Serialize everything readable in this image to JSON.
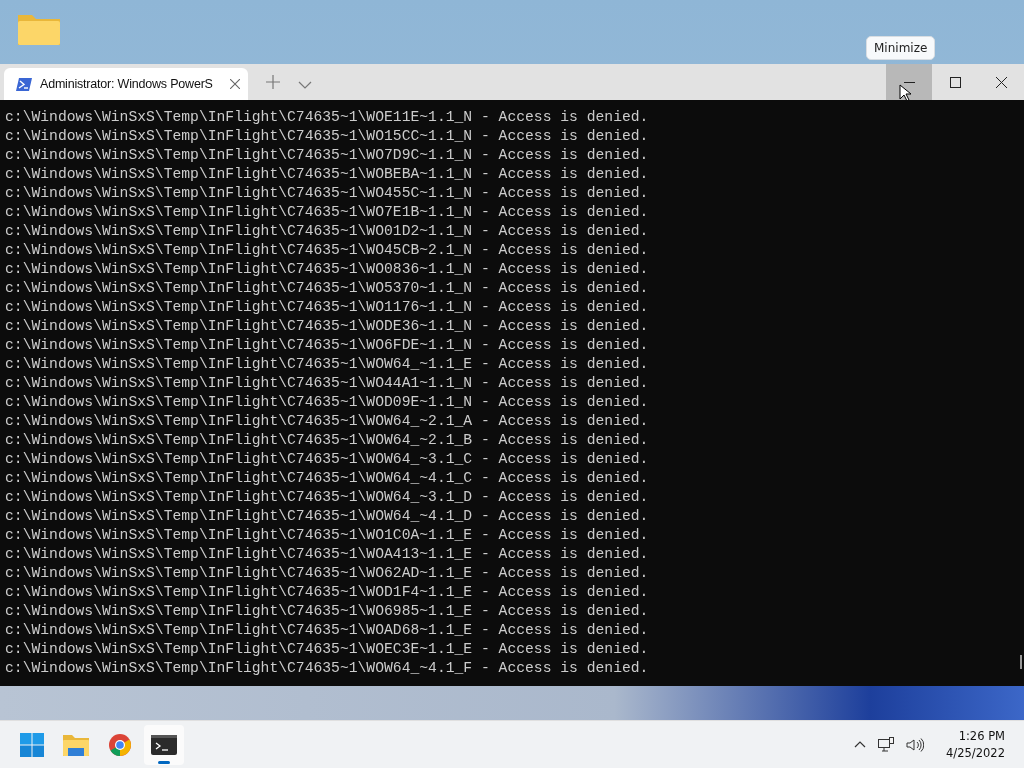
{
  "window": {
    "tab": {
      "title": "Administrator: Windows PowerS",
      "selected": true
    },
    "caption_buttons": [
      {
        "kind": "minimize",
        "hovered": true
      },
      {
        "kind": "maximize",
        "hovered": false
      },
      {
        "kind": "close",
        "hovered": false
      }
    ],
    "tooltip": "Minimize"
  },
  "terminal": {
    "lines": [
      "c:\\Windows\\WinSxS\\Temp\\InFlight\\C74635~1\\WOE11E~1.1_N - Access is denied.",
      "c:\\Windows\\WinSxS\\Temp\\InFlight\\C74635~1\\WO15CC~1.1_N - Access is denied.",
      "c:\\Windows\\WinSxS\\Temp\\InFlight\\C74635~1\\WO7D9C~1.1_N - Access is denied.",
      "c:\\Windows\\WinSxS\\Temp\\InFlight\\C74635~1\\WOBEBA~1.1_N - Access is denied.",
      "c:\\Windows\\WinSxS\\Temp\\InFlight\\C74635~1\\WO455C~1.1_N - Access is denied.",
      "c:\\Windows\\WinSxS\\Temp\\InFlight\\C74635~1\\WO7E1B~1.1_N - Access is denied.",
      "c:\\Windows\\WinSxS\\Temp\\InFlight\\C74635~1\\WO01D2~1.1_N - Access is denied.",
      "c:\\Windows\\WinSxS\\Temp\\InFlight\\C74635~1\\WO45CB~2.1_N - Access is denied.",
      "c:\\Windows\\WinSxS\\Temp\\InFlight\\C74635~1\\WO0836~1.1_N - Access is denied.",
      "c:\\Windows\\WinSxS\\Temp\\InFlight\\C74635~1\\WO5370~1.1_N - Access is denied.",
      "c:\\Windows\\WinSxS\\Temp\\InFlight\\C74635~1\\WO1176~1.1_N - Access is denied.",
      "c:\\Windows\\WinSxS\\Temp\\InFlight\\C74635~1\\WODE36~1.1_N - Access is denied.",
      "c:\\Windows\\WinSxS\\Temp\\InFlight\\C74635~1\\WO6FDE~1.1_N - Access is denied.",
      "c:\\Windows\\WinSxS\\Temp\\InFlight\\C74635~1\\WOW64_~1.1_E - Access is denied.",
      "c:\\Windows\\WinSxS\\Temp\\InFlight\\C74635~1\\WO44A1~1.1_N - Access is denied.",
      "c:\\Windows\\WinSxS\\Temp\\InFlight\\C74635~1\\WOD09E~1.1_N - Access is denied.",
      "c:\\Windows\\WinSxS\\Temp\\InFlight\\C74635~1\\WOW64_~2.1_A - Access is denied.",
      "c:\\Windows\\WinSxS\\Temp\\InFlight\\C74635~1\\WOW64_~2.1_B - Access is denied.",
      "c:\\Windows\\WinSxS\\Temp\\InFlight\\C74635~1\\WOW64_~3.1_C - Access is denied.",
      "c:\\Windows\\WinSxS\\Temp\\InFlight\\C74635~1\\WOW64_~4.1_C - Access is denied.",
      "c:\\Windows\\WinSxS\\Temp\\InFlight\\C74635~1\\WOW64_~3.1_D - Access is denied.",
      "c:\\Windows\\WinSxS\\Temp\\InFlight\\C74635~1\\WOW64_~4.1_D - Access is denied.",
      "c:\\Windows\\WinSxS\\Temp\\InFlight\\C74635~1\\WO1C0A~1.1_E - Access is denied.",
      "c:\\Windows\\WinSxS\\Temp\\InFlight\\C74635~1\\WOA413~1.1_E - Access is denied.",
      "c:\\Windows\\WinSxS\\Temp\\InFlight\\C74635~1\\WO62AD~1.1_E - Access is denied.",
      "c:\\Windows\\WinSxS\\Temp\\InFlight\\C74635~1\\WOD1F4~1.1_E - Access is denied.",
      "c:\\Windows\\WinSxS\\Temp\\InFlight\\C74635~1\\WO6985~1.1_E - Access is denied.",
      "c:\\Windows\\WinSxS\\Temp\\InFlight\\C74635~1\\WOAD68~1.1_E - Access is denied.",
      "c:\\Windows\\WinSxS\\Temp\\InFlight\\C74635~1\\WOEC3E~1.1_E - Access is denied.",
      "c:\\Windows\\WinSxS\\Temp\\InFlight\\C74635~1\\WOW64_~4.1_F - Access is denied."
    ]
  },
  "taskbar": {
    "apps": [
      {
        "kind": "start",
        "active": false
      },
      {
        "kind": "explorer",
        "active": false
      },
      {
        "kind": "browser",
        "active": false
      },
      {
        "kind": "terminal",
        "active": true
      }
    ],
    "clock": {
      "time": "1:26 PM",
      "date": "4/25/2022"
    }
  }
}
